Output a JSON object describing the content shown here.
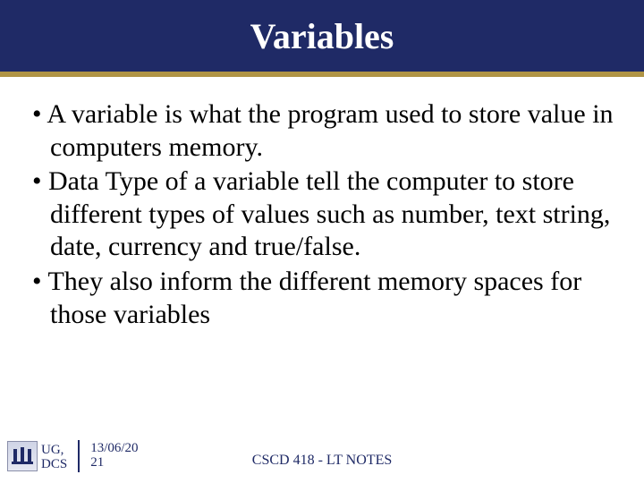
{
  "title": "Variables",
  "bullets": [
    "A variable is what the program used to store value in computers memory.",
    "Data Type of a variable tell the computer to store different types of values such as number, text string, date, currency and true/false.",
    "They also inform the different memory spaces for those variables"
  ],
  "footer": {
    "org_line1": "UG,",
    "org_line2": "DCS",
    "date_line1": "13/06/20",
    "date_line2": "21",
    "course": "CSCD 418 - LT NOTES"
  }
}
